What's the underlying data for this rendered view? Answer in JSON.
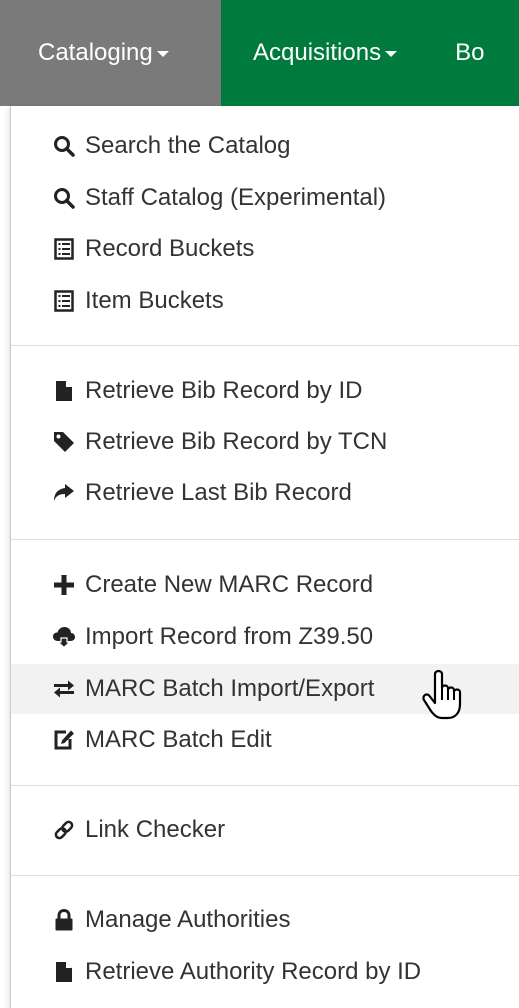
{
  "navbar": {
    "menus": [
      {
        "label": "Cataloging",
        "active": true
      },
      {
        "label": "Acquisitions",
        "active": false
      },
      {
        "label": "Bo",
        "active": false
      }
    ]
  },
  "menu": {
    "groups": [
      [
        {
          "label": "Search the Catalog",
          "icon": "search-icon"
        },
        {
          "label": "Staff Catalog (Experimental)",
          "icon": "search-icon"
        },
        {
          "label": "Record Buckets",
          "icon": "list-alt-icon"
        },
        {
          "label": "Item Buckets",
          "icon": "list-alt-icon"
        }
      ],
      [
        {
          "label": "Retrieve Bib Record by ID",
          "icon": "file-icon"
        },
        {
          "label": "Retrieve Bib Record by TCN",
          "icon": "tag-icon"
        },
        {
          "label": "Retrieve Last Bib Record",
          "icon": "share-arrow-icon"
        }
      ],
      [
        {
          "label": "Create New MARC Record",
          "icon": "plus-icon"
        },
        {
          "label": "Import Record from Z39.50",
          "icon": "cloud-download-icon"
        },
        {
          "label": "MARC Batch Import/Export",
          "icon": "transfer-icon",
          "hovered": true
        },
        {
          "label": "MARC Batch Edit",
          "icon": "edit-icon"
        }
      ],
      [
        {
          "label": "Link Checker",
          "icon": "link-icon"
        }
      ],
      [
        {
          "label": "Manage Authorities",
          "icon": "lock-icon"
        },
        {
          "label": "Retrieve Authority Record by ID",
          "icon": "file-icon"
        }
      ]
    ]
  },
  "colors": {
    "navbar_bg": "#007a3d",
    "active_menu_bg": "#7a7a7a",
    "hover_bg": "#f2f2f2",
    "text": "#333333"
  }
}
